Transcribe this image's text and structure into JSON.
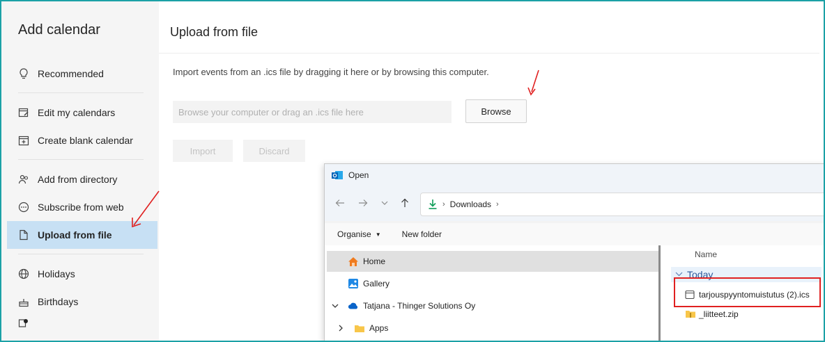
{
  "sidebar": {
    "title": "Add calendar",
    "items": [
      {
        "label": "Recommended",
        "icon": "lightbulb-icon"
      },
      {
        "label": "Edit my calendars",
        "icon": "edit-calendar-icon"
      },
      {
        "label": "Create blank calendar",
        "icon": "calendar-add-icon"
      },
      {
        "label": "Add from directory",
        "icon": "people-icon"
      },
      {
        "label": "Subscribe from web",
        "icon": "ellipsis-circle-icon"
      },
      {
        "label": "Upload from file",
        "icon": "document-icon",
        "active": true
      },
      {
        "label": "Holidays",
        "icon": "globe-icon"
      },
      {
        "label": "Birthdays",
        "icon": "cake-icon"
      }
    ]
  },
  "main": {
    "title": "Upload from file",
    "instructions": "Import events from an .ics file by dragging it here or by browsing this computer.",
    "file_placeholder": "Browse your computer or drag an .ics file here",
    "browse_label": "Browse",
    "import_label": "Import",
    "discard_label": "Discard"
  },
  "dialog": {
    "title": "Open",
    "address": {
      "folder": "Downloads"
    },
    "toolbar": {
      "organise": "Organise",
      "new_folder": "New folder"
    },
    "tree": [
      {
        "label": "Home",
        "icon": "home-icon",
        "selected": true
      },
      {
        "label": "Gallery",
        "icon": "gallery-icon"
      },
      {
        "label": "Tatjana - Thinger Solutions Oy",
        "icon": "cloud-icon"
      },
      {
        "label": "Apps",
        "icon": "folder-icon"
      }
    ],
    "files": {
      "column_name": "Name",
      "group": "Today",
      "items": [
        {
          "name": "tarjouspyyntomuistutus (2).ics",
          "icon": "calendar-file-icon"
        },
        {
          "name": "_liitteet.zip",
          "icon": "zip-folder-icon"
        }
      ]
    }
  },
  "colors": {
    "accent_active": "#c7e0f4",
    "frame_border": "#1ba1a6",
    "annotation_red": "#e02020"
  }
}
